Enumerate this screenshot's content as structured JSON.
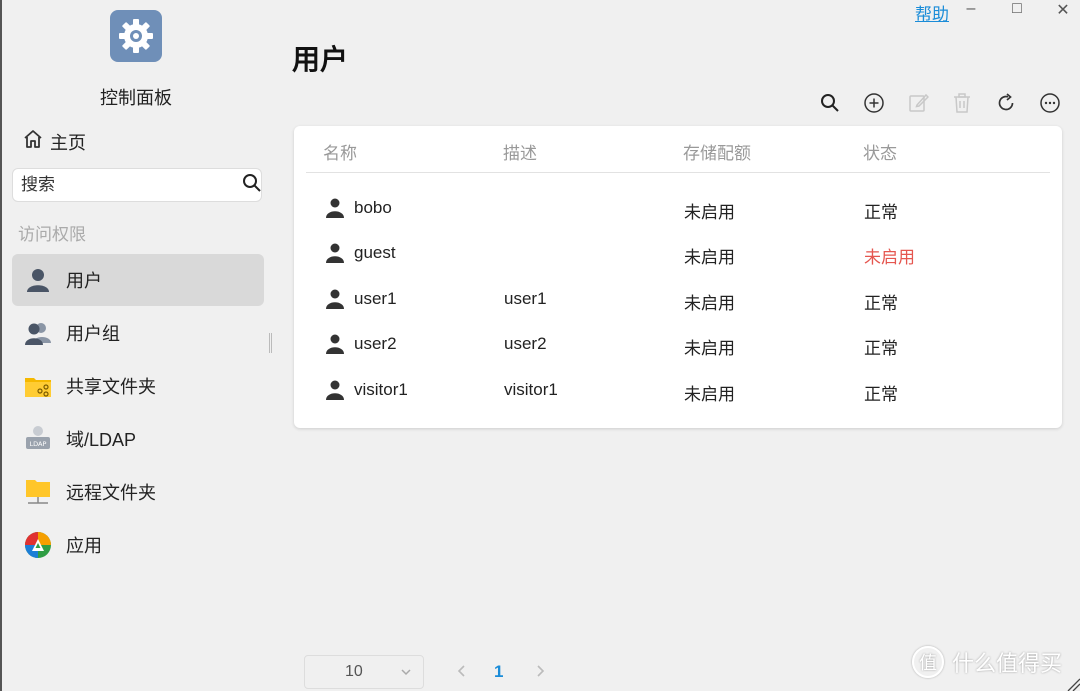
{
  "window": {
    "help_label": "帮助",
    "minimize_glyph": "–",
    "maximize_glyph": "□",
    "close_glyph": "✕"
  },
  "sidebar": {
    "app_title": "控制面板",
    "app_icon": "gear-icon",
    "home_label": "主页",
    "search_placeholder": "搜索",
    "section_label": "访问权限",
    "items": [
      {
        "label": "用户",
        "icon": "user-icon",
        "active": true
      },
      {
        "label": "用户组",
        "icon": "user-group-icon",
        "active": false
      },
      {
        "label": "共享文件夹",
        "icon": "shared-folder-icon",
        "active": false
      },
      {
        "label": "域/LDAP",
        "icon": "ldap-icon",
        "active": false
      },
      {
        "label": "远程文件夹",
        "icon": "remote-folder-icon",
        "active": false
      },
      {
        "label": "应用",
        "icon": "app-icon",
        "active": false
      }
    ]
  },
  "main": {
    "title": "用户",
    "toolbar": [
      "search-icon",
      "add-icon",
      "edit-icon",
      "delete-icon",
      "refresh-icon",
      "more-icon"
    ],
    "columns": [
      "名称",
      "描述",
      "存储配额",
      "状态"
    ],
    "rows": [
      {
        "name": "bobo",
        "description": "",
        "quota": "未启用",
        "status": "正常",
        "status_disabled": false
      },
      {
        "name": "guest",
        "description": "",
        "quota": "未启用",
        "status": "未启用",
        "status_disabled": true
      },
      {
        "name": "user1",
        "description": "user1",
        "quota": "未启用",
        "status": "正常",
        "status_disabled": false
      },
      {
        "name": "user2",
        "description": "user2",
        "quota": "未启用",
        "status": "正常",
        "status_disabled": false
      },
      {
        "name": "visitor1",
        "description": "visitor1",
        "quota": "未启用",
        "status": "正常",
        "status_disabled": false
      }
    ]
  },
  "pagination": {
    "page_size": "10",
    "current_page": "1"
  },
  "watermark": {
    "glyph": "值",
    "text": "什么值得买"
  },
  "colors": {
    "accent": "#1a8cd8",
    "status_disabled": "#e5564f",
    "active_nav_bg": "#d9d9d9",
    "app_icon_bg": "#6f8fb8"
  }
}
